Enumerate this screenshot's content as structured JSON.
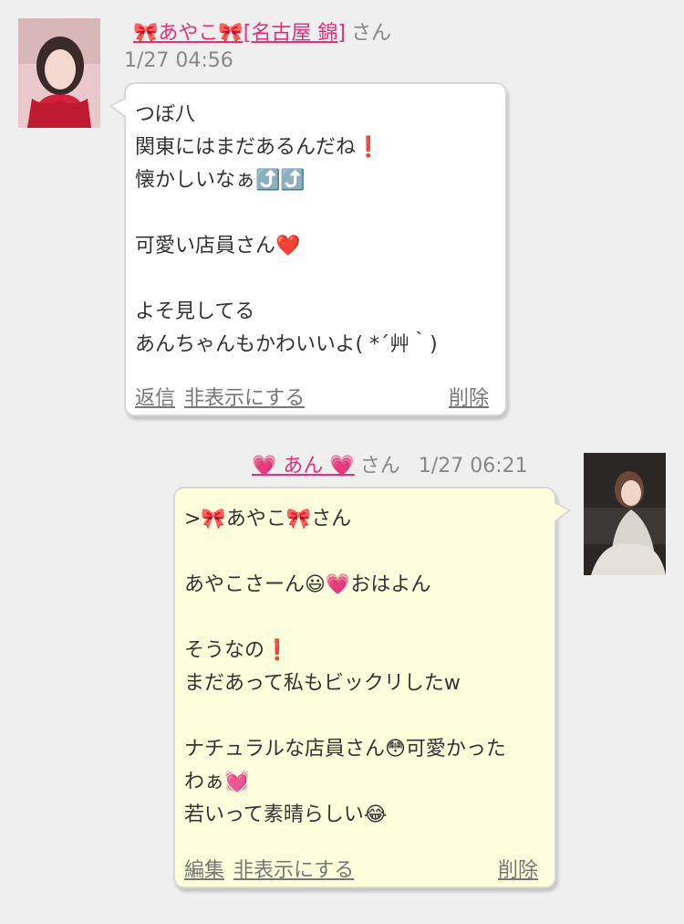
{
  "messages": [
    {
      "sender_name": "🎀あやこ🎀[名古屋 錦]",
      "honorific": "さん",
      "time": "1/27 04:56",
      "body": "つぼ八\n関東にはまだあるんだね❗\n懐かしいなぁ⤴️⤴️\n\n可愛い店員さん❤️\n\nよそ見してる\nあんちゃんもかわいいよ( *´艸｀)",
      "actions": [
        "返信",
        "非表示にする",
        "削除"
      ]
    },
    {
      "sender_name": "💗 あん 💗",
      "honorific": "さん",
      "time": "1/27 06:21",
      "body": ">🎀あやこ🎀さん\n\nあやこさーん😃💗おはよん\n\nそうなの❗\nまだあって私もビックリしたw\n\nナチュラルな店員さん😳可愛かった\nわぁ💓\n若いって素晴らしい😂",
      "actions": [
        "編集",
        "非表示にする",
        "削除"
      ]
    }
  ],
  "colors": {
    "background": "#efefef",
    "name_link": "#e0317a",
    "incoming_bubble": "#ffffff",
    "outgoing_bubble": "#ffffdd",
    "muted_text": "#888888"
  }
}
